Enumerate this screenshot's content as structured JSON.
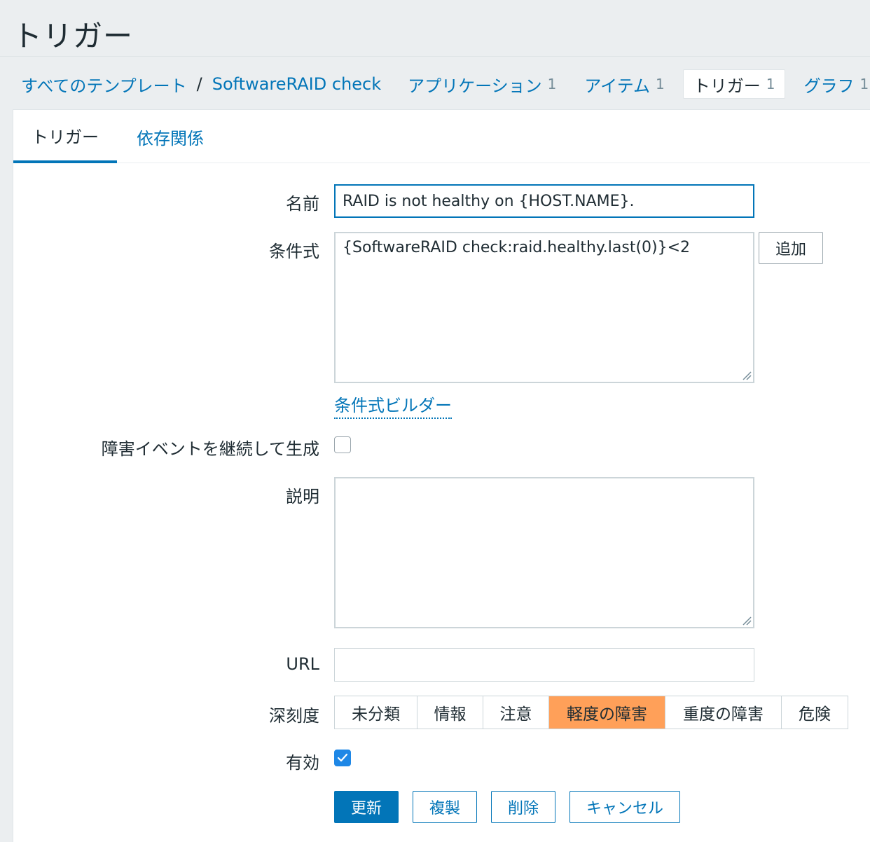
{
  "page": {
    "title": "トリガー"
  },
  "breadcrumb": {
    "all_templates": "すべてのテンプレート",
    "separator": "/",
    "template_name": "SoftwareRAID check"
  },
  "nav_tabs": [
    {
      "label": "アプリケーション",
      "count": "1",
      "active": false
    },
    {
      "label": "アイテム",
      "count": "1",
      "active": false
    },
    {
      "label": "トリガー",
      "count": "1",
      "active": true
    },
    {
      "label": "グラフ",
      "count": "1",
      "active": false
    }
  ],
  "form_tabs": {
    "trigger": "トリガー",
    "dependencies": "依存関係"
  },
  "form": {
    "name_label": "名前",
    "name_value": "RAID is not healthy on {HOST.NAME}.",
    "expression_label": "条件式",
    "expression_value": "{SoftwareRAID check:raid.healthy.last(0)}<2",
    "add_button": "追加",
    "expression_builder": "条件式ビルダー",
    "multiple_events_label": "障害イベントを継続して生成",
    "multiple_events_checked": false,
    "description_label": "説明",
    "description_value": "",
    "url_label": "URL",
    "url_value": "",
    "severity_label": "深刻度",
    "severities": [
      "未分類",
      "情報",
      "注意",
      "軽度の障害",
      "重度の障害",
      "危険"
    ],
    "severity_selected": "軽度の障害",
    "severity_selected_color": "#ffa059",
    "enabled_label": "有効",
    "enabled_checked": true
  },
  "actions": {
    "update": "更新",
    "clone": "複製",
    "delete": "削除",
    "cancel": "キャンセル"
  },
  "colors": {
    "link": "#0275b8",
    "primary": "#0275b8",
    "checkbox_checked": "#1e87e6"
  }
}
